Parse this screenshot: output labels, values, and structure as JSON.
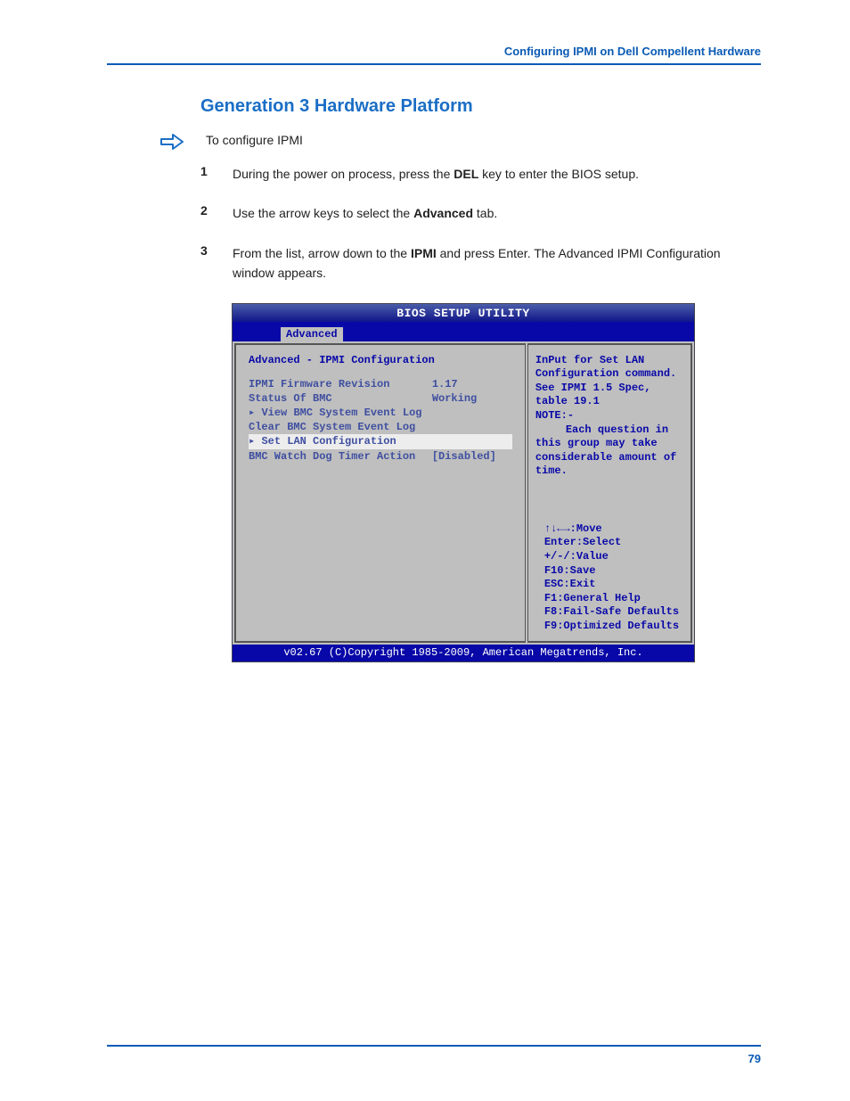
{
  "header": {
    "breadcrumb": "Configuring IPMI on Dell Compellent Hardware"
  },
  "section": {
    "title": "Generation 3 Hardware Platform"
  },
  "arrow_intro": "To configure IPMI",
  "steps": [
    {
      "num": "1",
      "pre": "During the power on process, press the ",
      "bold": "DEL",
      "post": " key to enter the BIOS setup."
    },
    {
      "num": "2",
      "pre": "Use the arrow keys to select the ",
      "bold": "Advanced",
      "post": " tab."
    },
    {
      "num": "3",
      "pre": "From the list, arrow down to the ",
      "bold": "IPMI",
      "post": " and press Enter. The Advanced IPMI Configuration window appears."
    }
  ],
  "bios": {
    "title": "BIOS SETUP UTILITY",
    "tab": "Advanced",
    "panel_title": "Advanced - IPMI Configuration",
    "rows": [
      {
        "label": "IPMI Firmware Revision",
        "value": "1.17",
        "selected": false,
        "arrow": false
      },
      {
        "label": "Status Of BMC",
        "value": "Working",
        "selected": false,
        "arrow": false
      },
      {
        "label": "View BMC System Event Log",
        "value": "",
        "selected": false,
        "arrow": true
      },
      {
        "label": "Clear BMC System Event Log",
        "value": "",
        "selected": false,
        "arrow": false
      },
      {
        "label": "Set LAN Configuration",
        "value": "",
        "selected": true,
        "arrow": true
      },
      {
        "label": "BMC Watch Dog Timer Action",
        "value": "[Disabled]",
        "selected": false,
        "arrow": false
      }
    ],
    "help": {
      "l1": "InPut for Set LAN",
      "l2": "Configuration command.",
      "l3": "See IPMI 1.5 Spec,",
      "l4": "table 19.1",
      "l5": "NOTE:-",
      "l6": "Each question in",
      "l7": "this group may take",
      "l8": "considerable amount of",
      "l9": "time."
    },
    "nav": {
      "n1": "↑↓←→:Move",
      "n2": "Enter:Select",
      "n3": "+/-/:Value",
      "n4": "F10:Save",
      "n5": "ESC:Exit",
      "n6": "F1:General Help",
      "n7": "F8:Fail-Safe Defaults",
      "n8": "F9:Optimized Defaults"
    },
    "footer": "v02.67 (C)Copyright 1985-2009, American Megatrends, Inc."
  },
  "page_num": "79"
}
